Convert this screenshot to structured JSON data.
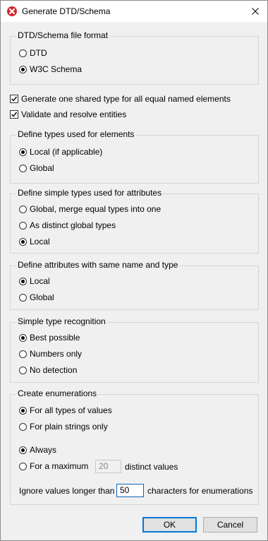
{
  "window": {
    "title": "Generate DTD/Schema",
    "icons": {
      "app": "x-logo-icon",
      "close": "close-icon"
    }
  },
  "file_format": {
    "legend": "DTD/Schema file format",
    "options": [
      {
        "label": "DTD",
        "selected": false
      },
      {
        "label": "W3C Schema",
        "selected": true
      }
    ]
  },
  "checkboxes": [
    {
      "label": "Generate one shared type for all equal named elements",
      "checked": true
    },
    {
      "label": "Validate and resolve entities",
      "checked": true
    }
  ],
  "element_types": {
    "legend": "Define types used for elements",
    "options": [
      {
        "label": "Local (if applicable)",
        "selected": true
      },
      {
        "label": "Global",
        "selected": false
      }
    ]
  },
  "attribute_types": {
    "legend": "Define simple types used for attributes",
    "options": [
      {
        "label": "Global, merge equal types into one",
        "selected": false
      },
      {
        "label": "As distinct global types",
        "selected": false
      },
      {
        "label": "Local",
        "selected": true
      }
    ]
  },
  "same_name_attrs": {
    "legend": "Define attributes with same name and type",
    "options": [
      {
        "label": "Local",
        "selected": true
      },
      {
        "label": "Global",
        "selected": false
      }
    ]
  },
  "type_recognition": {
    "legend": "Simple type recognition",
    "options": [
      {
        "label": "Best possible",
        "selected": true
      },
      {
        "label": "Numbers only",
        "selected": false
      },
      {
        "label": "No detection",
        "selected": false
      }
    ]
  },
  "enumerations": {
    "legend": "Create enumerations",
    "scope_options": [
      {
        "label": "For all types of values",
        "selected": true
      },
      {
        "label": "For plain strings only",
        "selected": false
      }
    ],
    "count_options": [
      {
        "label": "Always",
        "selected": true
      },
      {
        "label": "For a maximum",
        "selected": false
      }
    ],
    "max_value": "20",
    "max_suffix": "distinct values",
    "ignore_prefix": "Ignore values longer than",
    "ignore_value": "50",
    "ignore_suffix": "characters for enumerations"
  },
  "buttons": {
    "ok": "OK",
    "cancel": "Cancel"
  }
}
